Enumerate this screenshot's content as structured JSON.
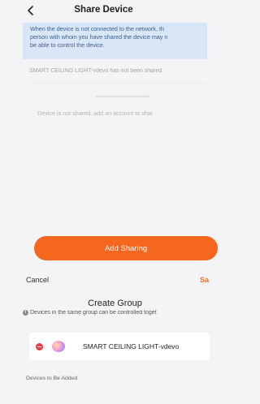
{
  "share_device": {
    "title": "Share Device",
    "info_banner_lines": [
      "When the device is not connected to the network, th",
      "person with whom you have shared the device may n",
      "be able to control the device."
    ],
    "not_shared_status": "SMART CEILING LIGHT-vdevo has not been shared",
    "empty_state": "Device is not shared, add an account to shar",
    "add_sharing_label": "Add Sharing"
  },
  "create_group": {
    "cancel_label": "Cancel",
    "save_label": "Sa",
    "title": "Create Group",
    "hint": "Devices in the same group can be controlled toget",
    "device": {
      "name": "SMART CEILING LIGHT-vdevo"
    },
    "to_be_added_label": "Devices to Be Added"
  },
  "icons": {
    "back": "chevron-left-icon",
    "info": "info-icon",
    "remove": "minus-circle-icon",
    "device": "ceiling-light-icon"
  },
  "colors": {
    "accent": "#f5661f",
    "banner_bg": "#d8e6f8",
    "banner_text": "#3d5f8c",
    "remove_red": "#ee3b3b"
  }
}
